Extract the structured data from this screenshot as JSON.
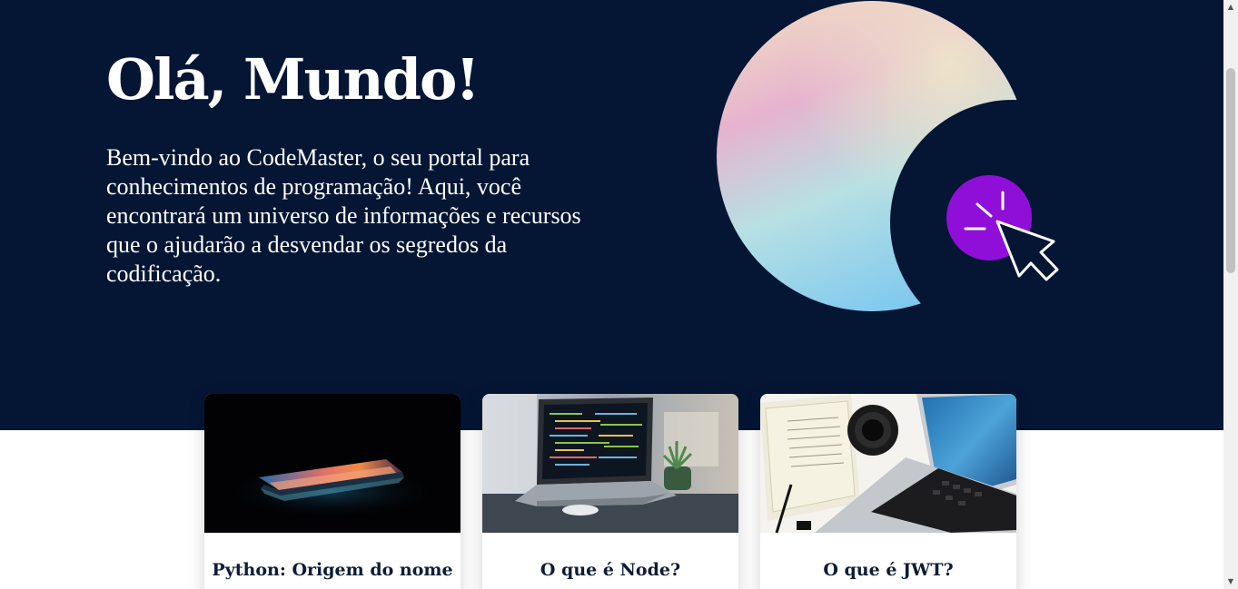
{
  "hero": {
    "title": "Olá, Mundo!",
    "text": "Bem-vindo ao CodeMaster, o seu portal para conhecimentos de programação! Aqui, você encontrará um universo de informações e recursos que o ajudarão a desvendar os segredos da codificação."
  },
  "illustration": {
    "icon": "click-cursor-icon",
    "accent_color": "#8f0fd8"
  },
  "cards": [
    {
      "title": "Python: Origem do nome",
      "image": "laptop-dark-glow"
    },
    {
      "title": "O que é Node?",
      "image": "laptop-code-desk"
    },
    {
      "title": "O que é JWT?",
      "image": "laptop-camera-book"
    }
  ],
  "scrollbar": {
    "up_arrow": "▲",
    "down_arrow": "▼"
  },
  "colors": {
    "hero_background": "#041634",
    "text_light": "#ffffff",
    "card_title": "#0e1c36"
  }
}
